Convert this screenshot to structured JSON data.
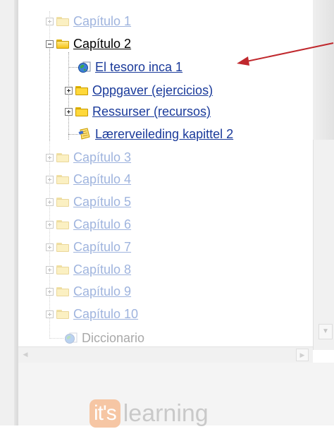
{
  "tree": {
    "items": [
      {
        "label": "Capítulo 1",
        "type": "folder",
        "state": "collapsed",
        "faded": true
      },
      {
        "label": "Capítulo 2",
        "type": "folder",
        "state": "expanded",
        "faded": false,
        "children": [
          {
            "label": "El tesoro inca 1",
            "type": "web-page"
          },
          {
            "label": "Oppgaver (ejercicios)",
            "type": "folder",
            "state": "collapsed"
          },
          {
            "label": "Ressurser (recursos)",
            "type": "folder",
            "state": "collapsed"
          },
          {
            "label": "Lærerveileding kapittel 2",
            "type": "document"
          }
        ]
      },
      {
        "label": "Capítulo 3",
        "type": "folder",
        "state": "collapsed",
        "faded": true
      },
      {
        "label": "Capítulo 4",
        "type": "folder",
        "state": "collapsed",
        "faded": true
      },
      {
        "label": "Capítulo 5",
        "type": "folder",
        "state": "collapsed",
        "faded": true
      },
      {
        "label": "Capítulo 6",
        "type": "folder",
        "state": "collapsed",
        "faded": true
      },
      {
        "label": "Capítulo 7",
        "type": "folder",
        "state": "collapsed",
        "faded": true
      },
      {
        "label": "Capítulo 8",
        "type": "folder",
        "state": "collapsed",
        "faded": true
      },
      {
        "label": "Capítulo 9",
        "type": "folder",
        "state": "collapsed",
        "faded": true
      },
      {
        "label": "Capítulo 10",
        "type": "folder",
        "state": "collapsed",
        "faded": true
      },
      {
        "label": "Diccionario",
        "type": "web-page",
        "faded": true
      }
    ]
  },
  "annotation": {
    "arrow_color": "#c0282d",
    "points_to": "El tesoro inca 1"
  },
  "logo": {
    "badge": "it's",
    "word": "learning"
  },
  "icons": {
    "folder": "folder-icon",
    "web_page": "globe-page-icon",
    "document": "document-icon",
    "expand": "plus-box-icon",
    "collapse": "minus-box-icon"
  },
  "colors": {
    "link": "#1a3a9a",
    "link_faded": "#9fb4de",
    "folder": "#ffd83a",
    "logo_badge": "#f6c6a4",
    "logo_text": "#c9c9c9"
  }
}
